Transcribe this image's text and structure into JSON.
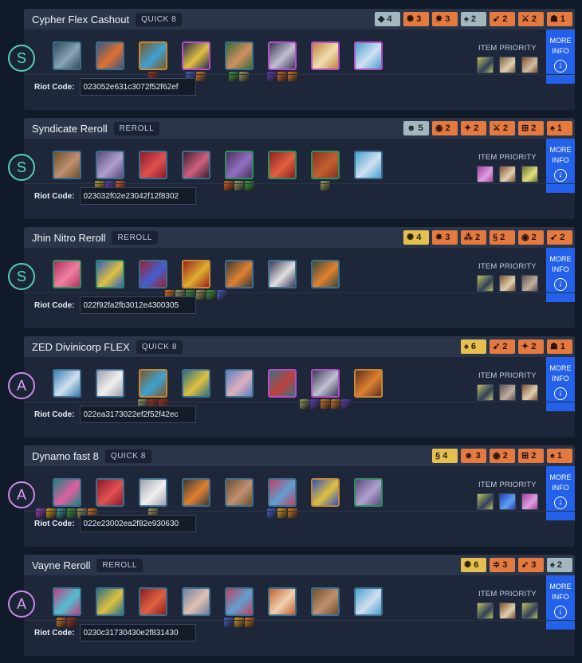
{
  "labels": {
    "item_priority": "ITEM PRIORITY",
    "more_info_1": "MORE",
    "more_info_2": "INFO",
    "riot_code": "Riot Code:"
  },
  "comps": [
    {
      "tier": "S",
      "title": "Cypher Flex Cashout",
      "tag": "QUICK 8",
      "traits": [
        {
          "glyph": "◆",
          "count": "4",
          "color": "silver"
        },
        {
          "glyph": "✺",
          "count": "3",
          "color": "bronze"
        },
        {
          "glyph": "✸",
          "count": "3",
          "color": "bronze"
        },
        {
          "glyph": "♠",
          "count": "2",
          "color": "silver"
        },
        {
          "glyph": "➹",
          "count": "2",
          "color": "bronze"
        },
        {
          "glyph": "⚔",
          "count": "2",
          "color": "bronze"
        },
        {
          "glyph": "☗",
          "count": "1",
          "color": "bronze"
        }
      ],
      "units": [
        {
          "c1": "#2f4a5e",
          "c2": "#8aa5b5",
          "border": "#3f6f8f",
          "items": []
        },
        {
          "c1": "#3a5580",
          "c2": "#e07030",
          "border": "#3f6f8f",
          "items": []
        },
        {
          "c1": "#7a5a2a",
          "c2": "#40a0d0",
          "border": "#c38a3a",
          "items": [
            "#b03020"
          ]
        },
        {
          "c1": "#2a2a50",
          "c2": "#e0c040",
          "border": "#b34fc8",
          "items": [
            "#4a60d0",
            "#e07a20"
          ]
        },
        {
          "c1": "#3a6a3a",
          "c2": "#d09060",
          "border": "#3f6f8f",
          "items": [
            "#40a040",
            "#a0a060"
          ]
        },
        {
          "c1": "#3a3a5a",
          "c2": "#c0c0d0",
          "border": "#b34fc8",
          "items": [
            "#6040c0",
            "#e06020",
            "#e07a20"
          ]
        },
        {
          "c1": "#c08040",
          "c2": "#f0e0b0",
          "border": "#b34fc8",
          "items": []
        },
        {
          "c1": "#4aa0d0",
          "c2": "#d0e0f0",
          "border": "#b34fc8",
          "items": []
        }
      ],
      "priority": [
        {
          "c1": "#c0c060",
          "c2": "#30405a"
        },
        {
          "c1": "#806040",
          "c2": "#e0d0b0"
        },
        {
          "c1": "#805030",
          "c2": "#d0c0a0"
        }
      ],
      "riot_code": "023052e631c3072f52f62ef"
    },
    {
      "tier": "S",
      "title": "Syndicate Reroll",
      "tag": "REROLL",
      "traits": [
        {
          "glyph": "☻",
          "count": "5",
          "color": "silver"
        },
        {
          "glyph": "◉",
          "count": "2",
          "color": "bronze"
        },
        {
          "glyph": "✦",
          "count": "2",
          "color": "bronze"
        },
        {
          "glyph": "⚔",
          "count": "2",
          "color": "bronze"
        },
        {
          "glyph": "⊞",
          "count": "2",
          "color": "bronze"
        },
        {
          "glyph": "♠",
          "count": "1",
          "color": "bronze"
        }
      ],
      "units": [
        {
          "c1": "#6a5030",
          "c2": "#c09070",
          "border": "#3f6f8f",
          "items": []
        },
        {
          "c1": "#5a4a7a",
          "c2": "#b0a0d0",
          "border": "#3f6f8f",
          "items": [
            "#c0a030",
            "#6040c0",
            "#e06020"
          ]
        },
        {
          "c1": "#8a1a2a",
          "c2": "#e05050",
          "border": "#3f6f8f",
          "items": []
        },
        {
          "c1": "#3a2030",
          "c2": "#d06080",
          "border": "#3f6f8f",
          "items": []
        },
        {
          "c1": "#4a3060",
          "c2": "#9070c0",
          "border": "#2e8f5f",
          "items": [
            "#e06020",
            "#a0a060",
            "#40a040"
          ]
        },
        {
          "c1": "#8a2020",
          "c2": "#e06040",
          "border": "#2e8f5f",
          "items": []
        },
        {
          "c1": "#8a3020",
          "c2": "#c06030",
          "border": "#2e8f5f",
          "items": [
            "#a0a060"
          ]
        },
        {
          "c1": "#4aa0d0",
          "c2": "#d0e0f0",
          "border": "#3f6f8f",
          "items": []
        }
      ],
      "priority": [
        {
          "c1": "#a040a0",
          "c2": "#e0a0e0"
        },
        {
          "c1": "#805030",
          "c2": "#e0d0b0"
        },
        {
          "c1": "#707030",
          "c2": "#e0e080"
        }
      ],
      "riot_code": "023032f02e23042f12f8302"
    },
    {
      "tier": "S",
      "title": "Jhin Nitro Reroll",
      "tag": "REROLL",
      "traits": [
        {
          "glyph": "✺",
          "count": "4",
          "color": "gold"
        },
        {
          "glyph": "✸",
          "count": "3",
          "color": "bronze"
        },
        {
          "glyph": "⁂",
          "count": "2",
          "color": "bronze"
        },
        {
          "glyph": "§",
          "count": "2",
          "color": "bronze"
        },
        {
          "glyph": "◉",
          "count": "2",
          "color": "bronze"
        },
        {
          "glyph": "➹",
          "count": "2",
          "color": "bronze"
        }
      ],
      "units": [
        {
          "c1": "#b03060",
          "c2": "#f080a0",
          "border": "#2e8f5f",
          "items": []
        },
        {
          "c1": "#3060c0",
          "c2": "#e0c040",
          "border": "#2e8f5f",
          "items": []
        },
        {
          "c1": "#a02030",
          "c2": "#4060d0",
          "border": "#3f6f8f",
          "items": []
        },
        {
          "c1": "#9a2020",
          "c2": "#e0b030",
          "border": "#c38a3a",
          "items": [
            "#e07a20",
            "#a0a060",
            "#40a040",
            "#a0a060",
            "#40a040",
            "#4a60d0"
          ]
        },
        {
          "c1": "#3a3a3a",
          "c2": "#e08030",
          "border": "#3f6f8f",
          "items": []
        },
        {
          "c1": "#3a3a5a",
          "c2": "#e0e0e0",
          "border": "#3f6f8f",
          "items": []
        },
        {
          "c1": "#3a4a3a",
          "c2": "#e08030",
          "border": "#3f6f8f",
          "items": []
        }
      ],
      "priority": [
        {
          "c1": "#c0c060",
          "c2": "#30405a"
        },
        {
          "c1": "#805030",
          "c2": "#e0d0b0"
        },
        {
          "c1": "#605050",
          "c2": "#c0b0a0"
        }
      ],
      "riot_code": "022f92fa2fb3012e4300305"
    },
    {
      "tier": "A",
      "title": "ZED Divinicorp FLEX",
      "tag": "QUICK 8",
      "traits": [
        {
          "glyph": "♠",
          "count": "6",
          "color": "gold"
        },
        {
          "glyph": "➹",
          "count": "2",
          "color": "bronze"
        },
        {
          "glyph": "✦",
          "count": "2",
          "color": "bronze"
        },
        {
          "glyph": "☗",
          "count": "1",
          "color": "bronze"
        }
      ],
      "units": [
        {
          "c1": "#3a80b0",
          "c2": "#d0e0f0",
          "border": "#3f6f8f",
          "items": []
        },
        {
          "c1": "#a0a0b0",
          "c2": "#f0f0f0",
          "border": "#3f6f8f",
          "items": []
        },
        {
          "c1": "#7a5a2a",
          "c2": "#40a0d0",
          "border": "#c38a3a",
          "items": [
            "#a0a060",
            "#b03020",
            "#b03020"
          ]
        },
        {
          "c1": "#2a7080",
          "c2": "#e0c040",
          "border": "#3f6f8f",
          "items": []
        },
        {
          "c1": "#5a80c0",
          "c2": "#e0b0c0",
          "border": "#3f6f8f",
          "items": []
        },
        {
          "c1": "#3a7080",
          "c2": "#c04040",
          "border": "#b34fc8",
          "items": []
        },
        {
          "c1": "#3a3a5a",
          "c2": "#c0c0d0",
          "border": "#b34fc8",
          "items": [
            "#a0a060",
            "#6040c0",
            "#e07a20",
            "#e07a20",
            "#6040c0"
          ]
        },
        {
          "c1": "#5a3020",
          "c2": "#e08030",
          "border": "#c38a3a",
          "items": []
        }
      ],
      "priority": [
        {
          "c1": "#c0c060",
          "c2": "#30405a"
        },
        {
          "c1": "#605050",
          "c2": "#c0b0a0"
        },
        {
          "c1": "#805030",
          "c2": "#e0d0b0"
        }
      ],
      "riot_code": "022ea3173022ef2f52f42ec"
    },
    {
      "tier": "A",
      "title": "Dynamo fast 8",
      "tag": "QUICK 8",
      "traits": [
        {
          "glyph": "§",
          "count": "4",
          "color": "gold"
        },
        {
          "glyph": "☻",
          "count": "3",
          "color": "bronze"
        },
        {
          "glyph": "◉",
          "count": "2",
          "color": "bronze"
        },
        {
          "glyph": "⊞",
          "count": "2",
          "color": "bronze"
        },
        {
          "glyph": "♠",
          "count": "1",
          "color": "bronze"
        }
      ],
      "units": [
        {
          "c1": "#208080",
          "c2": "#e060a0",
          "border": "#3f6f8f",
          "items": [
            "#a040c0",
            "#e0a020",
            "#40a0a0",
            "#40a040",
            "#a0a060",
            "#e07a20"
          ]
        },
        {
          "c1": "#8a1a2a",
          "c2": "#e05050",
          "border": "#3f6f8f",
          "items": []
        },
        {
          "c1": "#a0a0b0",
          "c2": "#f0f0f0",
          "border": "#3f6f8f",
          "items": [
            "#a0a060"
          ]
        },
        {
          "c1": "#3a3a3a",
          "c2": "#e08030",
          "border": "#3f6f8f",
          "items": []
        },
        {
          "c1": "#6a5030",
          "c2": "#c09070",
          "border": "#3f6f8f",
          "items": []
        },
        {
          "c1": "#c04060",
          "c2": "#60a0d0",
          "border": "#3f6f8f",
          "items": [
            "#4a60d0",
            "#e0a020",
            "#e07a20"
          ]
        },
        {
          "c1": "#3050c0",
          "c2": "#e0c040",
          "border": "#c38a3a",
          "items": []
        },
        {
          "c1": "#5a4a7a",
          "c2": "#b0a0d0",
          "border": "#2e8f5f",
          "items": []
        }
      ],
      "priority": [
        {
          "c1": "#c0c060",
          "c2": "#30405a"
        },
        {
          "c1": "#2040c0",
          "c2": "#60a0f0"
        },
        {
          "c1": "#a040a0",
          "c2": "#e0a0e0"
        }
      ],
      "riot_code": "022e23002ea2f82e930630"
    },
    {
      "tier": "A",
      "title": "Vayne Reroll",
      "tag": "REROLL",
      "traits": [
        {
          "glyph": "✺",
          "count": "6",
          "color": "gold"
        },
        {
          "glyph": "≑",
          "count": "3",
          "color": "bronze"
        },
        {
          "glyph": "➹",
          "count": "3",
          "color": "bronze"
        },
        {
          "glyph": "♠",
          "count": "2",
          "color": "silver"
        }
      ],
      "units": [
        {
          "c1": "#c04080",
          "c2": "#50c0d0",
          "border": "#3f6f8f",
          "items": [
            "#e07a20",
            "#b03020"
          ]
        },
        {
          "c1": "#2a7080",
          "c2": "#e0c040",
          "border": "#3f6f8f",
          "items": []
        },
        {
          "c1": "#8a2020",
          "c2": "#e06040",
          "border": "#3f6f8f",
          "items": []
        },
        {
          "c1": "#7080a0",
          "c2": "#e0c0b0",
          "border": "#3f6f8f",
          "items": []
        },
        {
          "c1": "#c04060",
          "c2": "#60a0d0",
          "border": "#3f6f8f",
          "items": [
            "#4a60d0",
            "#e0a020",
            "#e07a20"
          ]
        },
        {
          "c1": "#c06030",
          "c2": "#f0d0b0",
          "border": "#3f6f8f",
          "items": []
        },
        {
          "c1": "#6a5030",
          "c2": "#c09070",
          "border": "#3f6f8f",
          "items": []
        },
        {
          "c1": "#4aa0d0",
          "c2": "#d0e0f0",
          "border": "#3f6f8f",
          "items": []
        }
      ],
      "priority": [
        {
          "c1": "#c0c060",
          "c2": "#30405a"
        },
        {
          "c1": "#805030",
          "c2": "#e0d0b0"
        },
        {
          "c1": "#c0c060",
          "c2": "#30405a"
        }
      ],
      "riot_code": "0230c31730430e2f831430"
    }
  ]
}
